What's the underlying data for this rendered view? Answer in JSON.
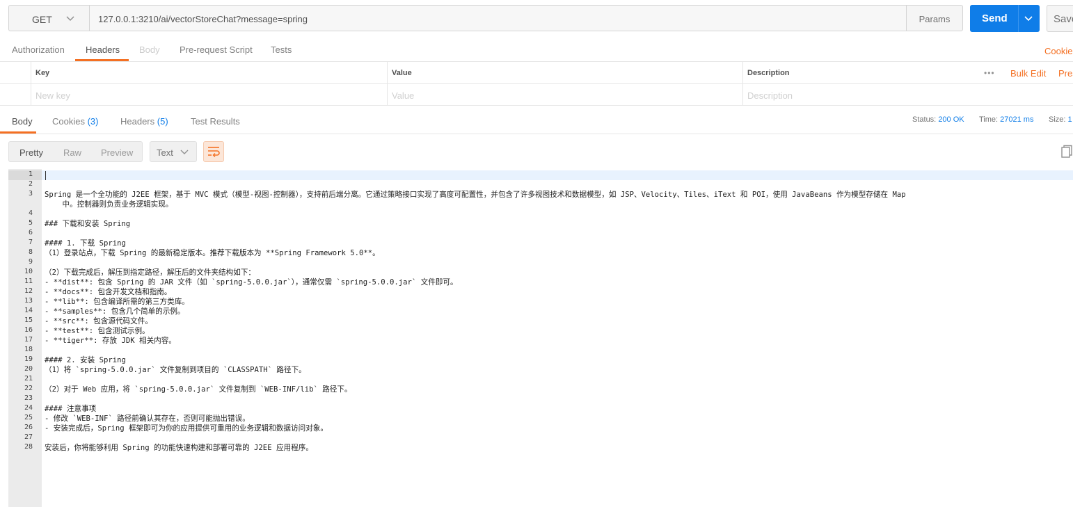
{
  "request": {
    "method": "GET",
    "url": "127.0.0.1:3210/ai/vectorStoreChat?message=spring",
    "params_label": "Params",
    "send_label": "Send",
    "save_label": "Save"
  },
  "request_tabs": {
    "authorization": "Authorization",
    "headers": "Headers",
    "body": "Body",
    "prerequest": "Pre-request Script",
    "tests": "Tests",
    "cookies": "Cookies"
  },
  "headers_table": {
    "col_key": "Key",
    "col_value": "Value",
    "col_description": "Description",
    "more": "•••",
    "bulk_edit": "Bulk Edit",
    "presets": "Pres",
    "placeholder_key": "New key",
    "placeholder_value": "Value",
    "placeholder_description": "Description"
  },
  "response_tabs": {
    "body": "Body",
    "cookies": "Cookies",
    "cookies_count": "(3)",
    "headers": "Headers",
    "headers_count": "(5)",
    "test_results": "Test Results"
  },
  "response_status": {
    "status_label": "Status:",
    "status_value": "200 OK",
    "time_label": "Time:",
    "time_value": "27021 ms",
    "size_label": "Size:",
    "size_value": "1"
  },
  "response_toolbar": {
    "pretty": "Pretty",
    "raw": "Raw",
    "preview": "Preview",
    "language": "Text"
  },
  "response_body": [
    {
      "n": "1",
      "text": ""
    },
    {
      "n": "2",
      "text": ""
    },
    {
      "n": "3",
      "text": "Spring 是一个全功能的 J2EE 框架，基于 MVC 模式（模型-视图-控制器），支持前后端分离。它通过策略接口实现了高度可配置性，并包含了许多视图技术和数据模型，如 JSP、Velocity、Tiles、iText 和 POI，使用 JavaBeans 作为模型存储在 Map"
    },
    {
      "n": "",
      "text": "    中。控制器则负责业务逻辑实现。"
    },
    {
      "n": "4",
      "text": ""
    },
    {
      "n": "5",
      "text": "### 下载和安装 Spring"
    },
    {
      "n": "6",
      "text": ""
    },
    {
      "n": "7",
      "text": "#### 1. 下载 Spring"
    },
    {
      "n": "8",
      "text": "（1）登录站点，下载 Spring 的最新稳定版本。推荐下载版本为 **Spring Framework 5.0**。"
    },
    {
      "n": "9",
      "text": ""
    },
    {
      "n": "10",
      "text": "（2）下载完成后，解压到指定路径，解压后的文件夹结构如下："
    },
    {
      "n": "11",
      "text": "- **dist**: 包含 Spring 的 JAR 文件（如 `spring-5.0.0.jar`），通常仅需 `spring-5.0.0.jar` 文件即可。"
    },
    {
      "n": "12",
      "text": "- **docs**: 包含开发文档和指南。"
    },
    {
      "n": "13",
      "text": "- **lib**: 包含编译所需的第三方类库。"
    },
    {
      "n": "14",
      "text": "- **samples**: 包含几个简单的示例。"
    },
    {
      "n": "15",
      "text": "- **src**: 包含源代码文件。"
    },
    {
      "n": "16",
      "text": "- **test**: 包含测试示例。"
    },
    {
      "n": "17",
      "text": "- **tiger**: 存放 JDK 相关内容。"
    },
    {
      "n": "18",
      "text": ""
    },
    {
      "n": "19",
      "text": "#### 2. 安装 Spring"
    },
    {
      "n": "20",
      "text": "（1）将 `spring-5.0.0.jar` 文件复制到项目的 `CLASSPATH` 路径下。"
    },
    {
      "n": "21",
      "text": ""
    },
    {
      "n": "22",
      "text": "（2）对于 Web 应用，将 `spring-5.0.0.jar` 文件复制到 `WEB-INF/lib` 路径下。"
    },
    {
      "n": "23",
      "text": ""
    },
    {
      "n": "24",
      "text": "#### 注意事项"
    },
    {
      "n": "25",
      "text": "- 修改 `WEB-INF` 路径前确认其存在，否则可能抛出错误。"
    },
    {
      "n": "26",
      "text": "- 安装完成后，Spring 框架即可为你的应用提供可重用的业务逻辑和数据访问对象。"
    },
    {
      "n": "27",
      "text": ""
    },
    {
      "n": "28",
      "text": "安装后，你将能够利用 Spring 的功能快速构建和部署可靠的 J2EE 应用程序。"
    }
  ],
  "colors": {
    "accent": "#f47023",
    "send": "#0f7de8",
    "link": "#0f7de8"
  }
}
